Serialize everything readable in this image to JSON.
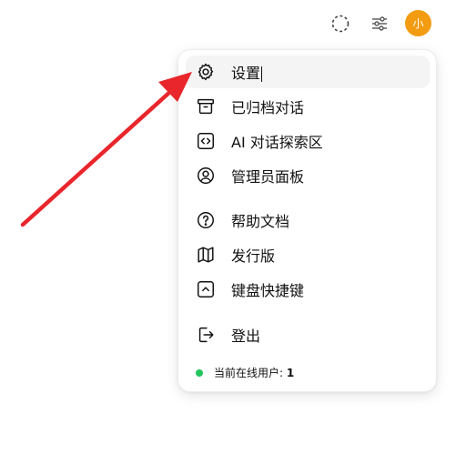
{
  "toolbar": {
    "icons": [
      "selection-dashed-circle-icon",
      "sliders-icon"
    ],
    "avatar_label": "小",
    "avatar_color": "#f39c12"
  },
  "menu": {
    "items": [
      {
        "label": "设置",
        "icon": "gear-icon",
        "active": true
      },
      {
        "label": "已归档对话",
        "icon": "archive-icon"
      },
      {
        "label": "AI 对话探索区",
        "icon": "code-square-icon"
      },
      {
        "label": "管理员面板",
        "icon": "user-circle-icon"
      },
      {
        "label": "帮助文档",
        "icon": "question-circle-icon"
      },
      {
        "label": "发行版",
        "icon": "map-icon"
      },
      {
        "label": "键盘快捷键",
        "icon": "chevron-up-square-icon"
      },
      {
        "label": "登出",
        "icon": "logout-icon"
      }
    ],
    "online": {
      "label": "当前在线用户: ",
      "count": "1",
      "dot_color": "#22c55e"
    }
  },
  "annotation": {
    "arrow_color": "#e8262b"
  }
}
